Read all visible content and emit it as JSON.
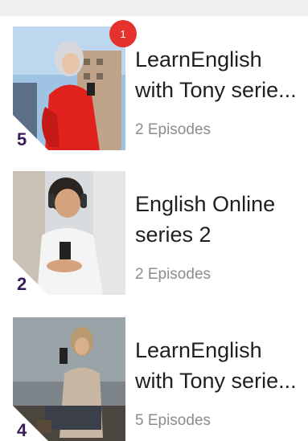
{
  "series": [
    {
      "title": "LearnEnglish\nwith Tony serie...",
      "episodes": "2 Episodes",
      "count": "5",
      "badge": "1"
    },
    {
      "title": "English Online\nseries 2",
      "episodes": "2 Episodes",
      "count": "2"
    },
    {
      "title": "LearnEnglish\nwith Tony serie...",
      "episodes": "5 Episodes",
      "count": "4"
    }
  ],
  "colors": {
    "badge": "#e5322d",
    "count_text": "#3b1a5a",
    "title_text": "#1f1f1f",
    "episodes_text": "#8c8c8c"
  }
}
